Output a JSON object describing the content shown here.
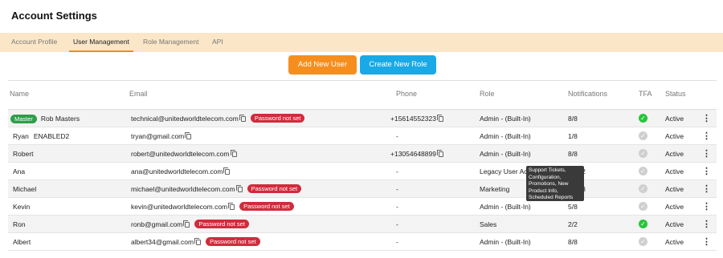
{
  "title": "Account Settings",
  "tabs": [
    {
      "label": "Account Profile"
    },
    {
      "label": "User Management"
    },
    {
      "label": "Role Management"
    },
    {
      "label": "API"
    }
  ],
  "actions": {
    "add_user": "Add New User",
    "create_role": "Create New Role"
  },
  "columns": [
    "Name",
    "Email",
    "Phone",
    "Role",
    "Notifications",
    "TFA",
    "Status"
  ],
  "rows": [
    {
      "badge": "Master",
      "name": "Rob Masters",
      "email": "technical@unitedworldtelecom.com",
      "email_badge": "Password not set",
      "phone": "+15614552323",
      "role": "Admin - (Built-In)",
      "notifications": "8/8",
      "tfa": true,
      "status": "Active"
    },
    {
      "name": "Ryan",
      "name_suffix": "ENABLED2",
      "email": "tryan@gmail.com",
      "phone": "-",
      "role": "Admin - (Built-In)",
      "notifications": "1/8",
      "tfa": false,
      "status": "Active"
    },
    {
      "name": "Robert",
      "email": "robert@unitedworldtelecom.com",
      "phone": "+13054648899",
      "role": "Admin - (Built-In)",
      "notifications": "8/8",
      "tfa": false,
      "status": "Active"
    },
    {
      "name": "Ana",
      "email": "ana@unitedworldtelecom.com",
      "phone": "-",
      "role": "Legacy User Acc",
      "notifications": "2/2",
      "tfa": false,
      "status": "Active"
    },
    {
      "name": "Michael",
      "email": "michael@unitedworldtelecom.com",
      "email_badge": "Password not set",
      "phone": "-",
      "role": "Marketing",
      "notifications": "5/8",
      "tfa": false,
      "status": "Active"
    },
    {
      "name": "Kevin",
      "email": "kevin@unitedworldtelecom.com",
      "email_badge": "Password not set",
      "phone": "-",
      "role": "Admin - (Built-In)",
      "notifications": "5/8",
      "tfa": false,
      "status": "Active"
    },
    {
      "name": "Ron",
      "email": "ronb@gmail.com",
      "email_badge": "Password not set",
      "phone": "-",
      "role": "Sales",
      "notifications": "2/2",
      "tfa": true,
      "status": "Active"
    },
    {
      "name": "Albert",
      "email": "albert34@gmail.com",
      "email_badge": "Password not set",
      "phone": "-",
      "role": "Admin - (Built-In)",
      "notifications": "8/8",
      "tfa": false,
      "status": "Active"
    }
  ],
  "tooltip": "Support Tickets, Configuration, Promotions, New Product Info, Scheduled Reports",
  "icons": {
    "copy": "copy-icon",
    "tfa": "check-circle-icon",
    "menu": "more-vertical-icon"
  },
  "colors": {
    "accent": "#f68e1e",
    "secondary": "#19a9e6",
    "danger": "#d12b3c",
    "success": "#27c43a"
  }
}
